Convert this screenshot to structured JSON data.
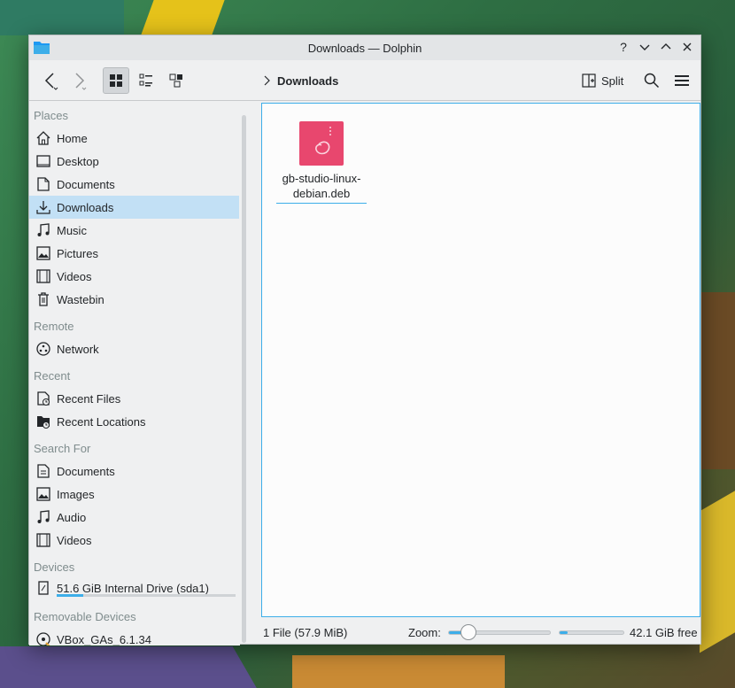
{
  "window": {
    "title": "Downloads — Dolphin",
    "controls": [
      "?",
      "⌄",
      "⌃",
      "✕"
    ]
  },
  "toolbar": {
    "breadcrumb": "Downloads",
    "split_label": "Split"
  },
  "sidebar": {
    "sections": {
      "places": "Places",
      "remote": "Remote",
      "recent": "Recent",
      "search_for": "Search For",
      "devices": "Devices",
      "removable": "Removable Devices"
    },
    "places": [
      {
        "label": "Home",
        "icon": "home-icon"
      },
      {
        "label": "Desktop",
        "icon": "desktop-icon"
      },
      {
        "label": "Documents",
        "icon": "documents-icon"
      },
      {
        "label": "Downloads",
        "icon": "download-icon",
        "selected": true
      },
      {
        "label": "Music",
        "icon": "music-icon"
      },
      {
        "label": "Pictures",
        "icon": "pictures-icon"
      },
      {
        "label": "Videos",
        "icon": "videos-icon"
      },
      {
        "label": "Wastebin",
        "icon": "trash-icon"
      }
    ],
    "remote": [
      {
        "label": "Network",
        "icon": "network-icon"
      }
    ],
    "recent": [
      {
        "label": "Recent Files",
        "icon": "recent-files-icon"
      },
      {
        "label": "Recent Locations",
        "icon": "recent-locations-icon"
      }
    ],
    "search_for": [
      {
        "label": "Documents",
        "icon": "documents-icon"
      },
      {
        "label": "Images",
        "icon": "images-icon"
      },
      {
        "label": "Audio",
        "icon": "audio-icon"
      },
      {
        "label": "Videos",
        "icon": "videos-icon"
      }
    ],
    "devices": [
      {
        "label": "51.6 GiB Internal Drive (sda1)",
        "icon": "drive-icon",
        "usage": 0.15
      }
    ],
    "removable": [
      {
        "label": "VBox_GAs_6.1.34",
        "icon": "optical-disc-icon"
      }
    ]
  },
  "content": {
    "files": [
      {
        "name": "gb-studio-linux-debian.deb",
        "icon": "deb-package-icon"
      }
    ]
  },
  "statusbar": {
    "summary": "1 File (57.9 MiB)",
    "zoom_label": "Zoom:",
    "zoom_level": 0.2,
    "free_space_fraction": 0.12,
    "free_text": "42.1 GiB free"
  },
  "colors": {
    "accent": "#3daee9",
    "selection": "#c2e0f5",
    "deb_icon": "#e8476e"
  }
}
